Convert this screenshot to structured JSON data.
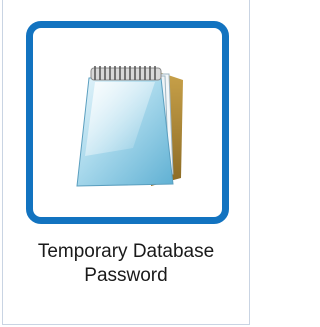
{
  "shortcut": {
    "title_line1": "Temporary Database",
    "title_line2": "Password",
    "icon": "notepad-icon",
    "selected": true,
    "accent_color": "#1273c0"
  }
}
